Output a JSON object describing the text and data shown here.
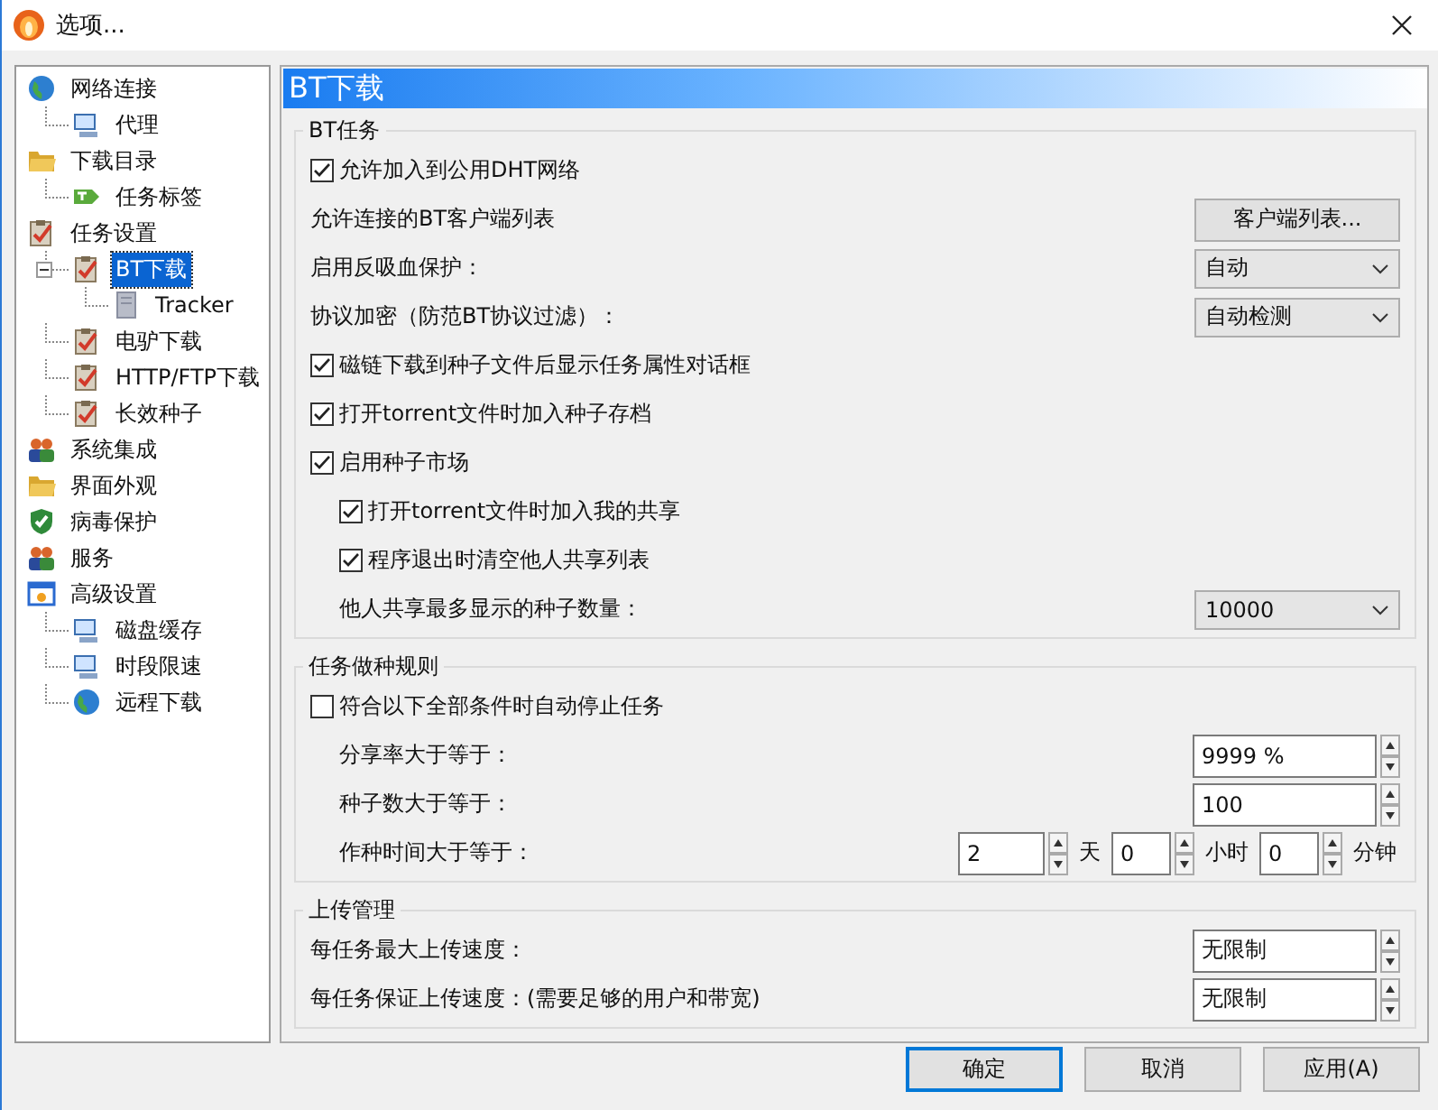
{
  "window": {
    "title": "选项..."
  },
  "tree": [
    {
      "label": "网络连接",
      "kind": "globe",
      "selected": false,
      "children": [
        {
          "label": "代理",
          "kind": "computer",
          "selected": false
        }
      ]
    },
    {
      "label": "下载目录",
      "kind": "folder",
      "selected": false,
      "children": [
        {
          "label": "任务标签",
          "kind": "tag",
          "selected": false
        }
      ]
    },
    {
      "label": "任务设置",
      "kind": "clipboard",
      "selected": false,
      "children": [
        {
          "label": "BT下载",
          "kind": "clipboard",
          "selected": true,
          "children": [
            {
              "label": "Tracker",
              "kind": "server",
              "selected": false
            }
          ]
        },
        {
          "label": "电驴下载",
          "kind": "clipboard",
          "selected": false
        },
        {
          "label": "HTTP/FTP下载",
          "kind": "clipboard",
          "selected": false
        },
        {
          "label": "长效种子",
          "kind": "clipboard",
          "selected": false
        }
      ]
    },
    {
      "label": "系统集成",
      "kind": "people",
      "selected": false
    },
    {
      "label": "界面外观",
      "kind": "folder",
      "selected": false
    },
    {
      "label": "病毒保护",
      "kind": "shield",
      "selected": false
    },
    {
      "label": "服务",
      "kind": "people",
      "selected": false
    },
    {
      "label": "高级设置",
      "kind": "window",
      "selected": false,
      "children": [
        {
          "label": "磁盘缓存",
          "kind": "computer",
          "selected": false
        },
        {
          "label": "时段限速",
          "kind": "computer",
          "selected": false
        },
        {
          "label": "远程下载",
          "kind": "globe",
          "selected": false
        }
      ]
    }
  ],
  "panel": {
    "title": "BT下载",
    "groups": [
      {
        "title": "BT任务",
        "rows": [
          {
            "kind": "checkbox",
            "label": "允许加入到公用DHT网络",
            "checked": true
          },
          {
            "kind": "button",
            "label": "允许连接的BT客户端列表",
            "button": "客户端列表..."
          },
          {
            "kind": "select",
            "label": "启用反吸血保护：",
            "value": "自动"
          },
          {
            "kind": "select",
            "label": "协议加密（防范BT协议过滤）：",
            "value": "自动检测"
          },
          {
            "kind": "checkbox",
            "label": "磁链下载到种子文件后显示任务属性对话框",
            "checked": true
          },
          {
            "kind": "checkbox",
            "label": "打开torrent文件时加入种子存档",
            "checked": true
          },
          {
            "kind": "checkbox",
            "label": "启用种子市场",
            "checked": true,
            "children": [
              {
                "kind": "checkbox",
                "label": "打开torrent文件时加入我的共享",
                "checked": true
              },
              {
                "kind": "checkbox",
                "label": "程序退出时清空他人共享列表",
                "checked": true
              },
              {
                "kind": "select",
                "label": "他人共享最多显示的种子数量：",
                "value": "10000"
              }
            ]
          }
        ]
      },
      {
        "title": "任务做种规则",
        "rows": [
          {
            "kind": "checkbox",
            "label": "符合以下全部条件时自动停止任务",
            "checked": false,
            "children": [
              {
                "kind": "spin",
                "label": "分享率大于等于：",
                "value": "9999 %"
              },
              {
                "kind": "spin",
                "label": "种子数大于等于：",
                "value": "100"
              },
              {
                "kind": "duration",
                "label": "作种时间大于等于：",
                "fields": [
                  {
                    "value": "2",
                    "unit": "天"
                  },
                  {
                    "value": "0",
                    "unit": "小时"
                  },
                  {
                    "value": "0",
                    "unit": "分钟"
                  }
                ]
              }
            ]
          }
        ]
      },
      {
        "title": "上传管理",
        "rows": [
          {
            "kind": "spin",
            "label": "每任务最大上传速度：",
            "value": "无限制"
          },
          {
            "kind": "spin",
            "label": "每任务保证上传速度：(需要足够的用户和带宽)",
            "value": "无限制"
          }
        ]
      }
    ]
  },
  "buttons": [
    {
      "label": "确定",
      "default": true
    },
    {
      "label": "取消",
      "default": false
    },
    {
      "label": "应用(A)",
      "default": false
    }
  ]
}
